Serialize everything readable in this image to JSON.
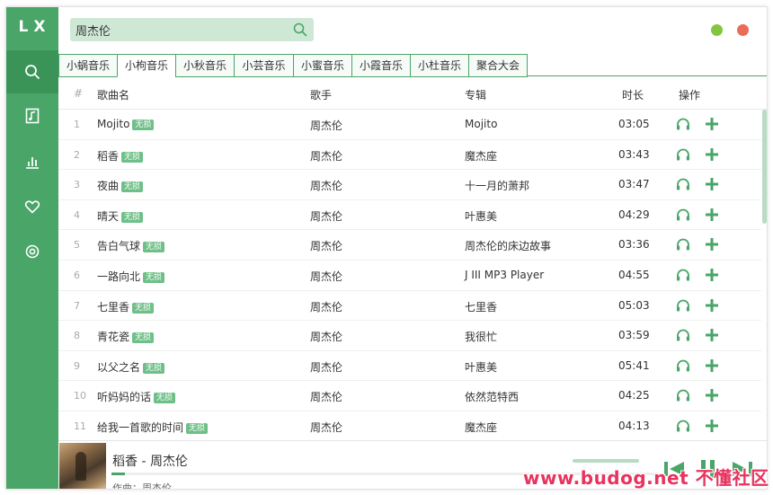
{
  "app": {
    "logo": "LX",
    "accent_color": "#4aa568"
  },
  "sidebar": {
    "items": [
      {
        "name": "search",
        "icon": "search-icon",
        "active": true
      },
      {
        "name": "playlist",
        "icon": "music-file-icon",
        "active": false
      },
      {
        "name": "charts",
        "icon": "bar-chart-icon",
        "active": false
      },
      {
        "name": "favorites",
        "icon": "heart-icon",
        "active": false
      },
      {
        "name": "settings",
        "icon": "gear-icon",
        "active": false
      }
    ]
  },
  "search": {
    "value": "周杰伦",
    "icon": "search-icon"
  },
  "window_controls": {
    "minimize_color": "#85c441",
    "close_color": "#ea6e56"
  },
  "tabs": [
    "小蜗音乐",
    "小枸音乐",
    "小秋音乐",
    "小芸音乐",
    "小蜜音乐",
    "小霞音乐",
    "小杜音乐",
    "聚合大会"
  ],
  "active_tab": 1,
  "table": {
    "headers": {
      "num": "#",
      "name": "歌曲名",
      "artist": "歌手",
      "album": "专辑",
      "duration": "时长",
      "actions": "操作"
    },
    "badge_label": "无损",
    "rows": [
      {
        "num": "1",
        "name": "Mojito",
        "artist": "周杰伦",
        "album": "Mojito",
        "duration": "03:05"
      },
      {
        "num": "2",
        "name": "稻香",
        "artist": "周杰伦",
        "album": "魔杰座",
        "duration": "03:43"
      },
      {
        "num": "3",
        "name": "夜曲",
        "artist": "周杰伦",
        "album": "十一月的萧邦",
        "duration": "03:47"
      },
      {
        "num": "4",
        "name": "晴天",
        "artist": "周杰伦",
        "album": "叶惠美",
        "duration": "04:29"
      },
      {
        "num": "5",
        "name": "告白气球",
        "artist": "周杰伦",
        "album": "周杰伦的床边故事",
        "duration": "03:36"
      },
      {
        "num": "6",
        "name": "一路向北",
        "artist": "周杰伦",
        "album": "J III MP3 Player",
        "duration": "04:55"
      },
      {
        "num": "7",
        "name": "七里香",
        "artist": "周杰伦",
        "album": "七里香",
        "duration": "05:03"
      },
      {
        "num": "8",
        "name": "青花瓷",
        "artist": "周杰伦",
        "album": "我很忙",
        "duration": "03:59"
      },
      {
        "num": "9",
        "name": "以父之名",
        "artist": "周杰伦",
        "album": "叶惠美",
        "duration": "05:41"
      },
      {
        "num": "10",
        "name": "听妈妈的话",
        "artist": "周杰伦",
        "album": "依然范特西",
        "duration": "04:25"
      },
      {
        "num": "11",
        "name": "给我一首歌的时间",
        "artist": "周杰伦",
        "album": "魔杰座",
        "duration": "04:13"
      }
    ]
  },
  "player": {
    "now_playing": "稻香 - 周杰伦",
    "lyric": "作曲：周杰伦",
    "progress": 0.025,
    "volume": 1.0
  },
  "watermark": "www.budog.net 不懂社区"
}
